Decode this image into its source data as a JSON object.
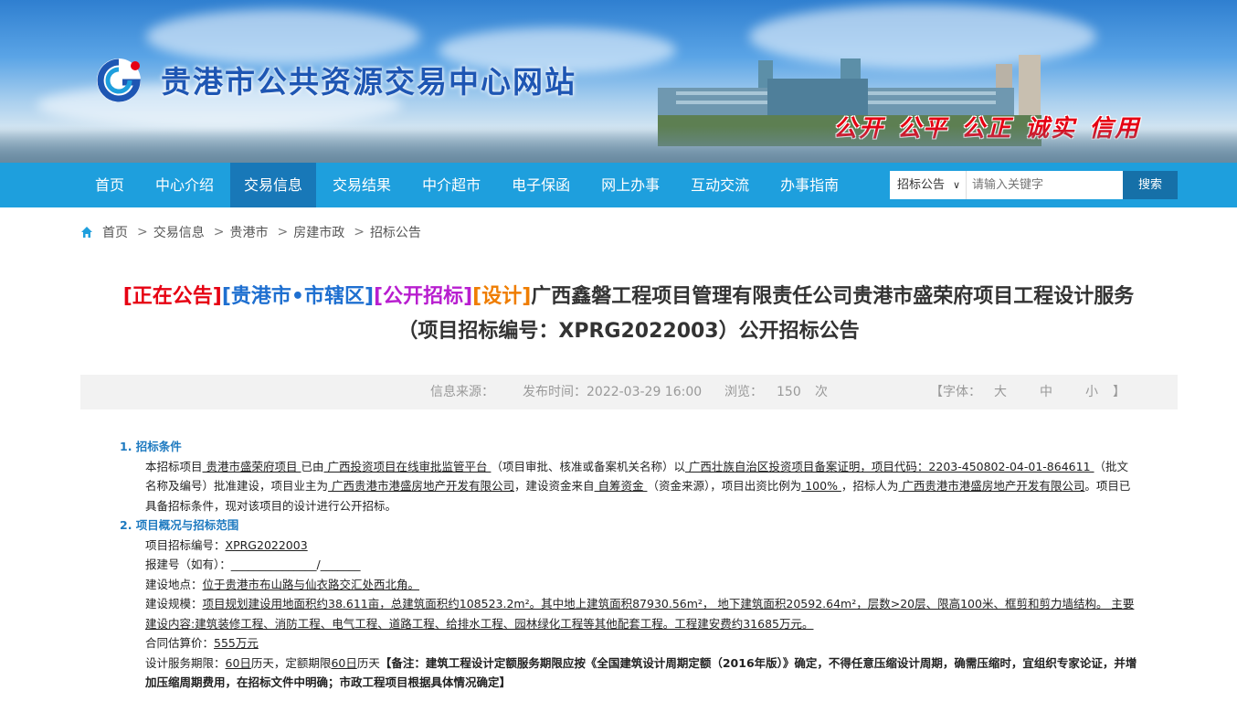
{
  "header": {
    "site_title": "贵港市公共资源交易中心网站",
    "motto": [
      "公开",
      "公平",
      "公正",
      "诚实",
      "信用"
    ]
  },
  "nav": {
    "items": [
      "首页",
      "中心介绍",
      "交易信息",
      "交易结果",
      "中介超市",
      "电子保函",
      "网上办事",
      "互动交流",
      "办事指南"
    ],
    "active": "交易信息"
  },
  "search": {
    "category": "招标公告",
    "placeholder": "请输入关键字",
    "button": "搜索"
  },
  "breadcrumb": [
    "首页",
    "交易信息",
    "贵港市",
    "房建市政",
    "招标公告"
  ],
  "article": {
    "tag_status": "[正在公告]",
    "tag_region": "[贵港市•市辖区]",
    "tag_method": "[公开招标]",
    "tag_type": "[设计]",
    "title_line1": "广西鑫磐工程项目管理有限责任公司贵港市盛荣府项目工程设计服务",
    "title_line2": "（项目招标编号：XPRG2022003）公开招标公告"
  },
  "meta": {
    "source_label": "信息来源：",
    "date_label": "发布时间：",
    "date": "2022-03-29 16:00",
    "views_label": "浏览：",
    "views": "150",
    "views_unit": "次",
    "font_label": "【字体：",
    "font_large": "大",
    "font_medium": "中",
    "font_small": "小",
    "font_close": "】"
  },
  "content": {
    "s1_heading": "1. 招标条件",
    "s1_a": "本招标项目",
    "s1_b": " 贵港市盛荣府项目 ",
    "s1_c": " 已由",
    "s1_d": " 广西投资项目在线审批监管平台 ",
    "s1_e": "（项目审批、核准或备案机关名称）以",
    "s1_f": " 广西壮族自治区投资项目备案证明，项目代码：2203-450802-04-01-864611 ",
    "s1_g": "（批文名称及编号）批准建设，项目业主为",
    "s1_h": "  广西贵港市港盛房地产开发有限公司",
    "s1_i": "，建设资金来自",
    "s1_j": "        自筹资金   ",
    "s1_k": " （资金来源），项目出资比例为",
    "s1_l": " 100% ",
    "s1_m": "，招标人为",
    "s1_n": " 广西贵港市港盛房地产开发有限公司",
    "s1_o": "。项目已具备招标条件，现对该项目的设计进行公开招标。",
    "s2_heading": "2. 项目概况与招标范围",
    "code_label": "项目招标编号：",
    "code_value": "XPRG2022003",
    "reg_label": "报建号（如有）：",
    "reg_value": "_______________/_______",
    "loc_label": "建设地点：",
    "loc_value": "位于贵港市布山路与仙衣路交汇处西北角。",
    "scale_label": "建设规模：",
    "scale_value": "项目规划建设用地面积约38.611亩，总建筑面积约108523.2m²。其中地上建筑面积87930.56m²， 地下建筑面积20592.64m²，层数>20层、限高100米、框剪和剪力墙结构。 主要建设内容:建筑装修工程、消防工程、电气工程、道路工程、给排水工程、园林绿化工程等其他配套工程。工程建安费约31685万元。",
    "price_label": "合同估算价：",
    "price_value": "555万元",
    "period_label": "设计服务期限：",
    "period_days": "60日",
    "period_mid": "历天，定额期限",
    "period_quota": "60日",
    "period_unit": "历天",
    "period_note": "【备注：建筑工程设计定额服务期限应按《全国建筑设计周期定额（2016年版）》确定，不得任意压缩设计周期，确需压缩时，宜组织专家论证，并增加压缩周期费用，在招标文件中明确；市政工程项目根据具体情况确定】"
  }
}
